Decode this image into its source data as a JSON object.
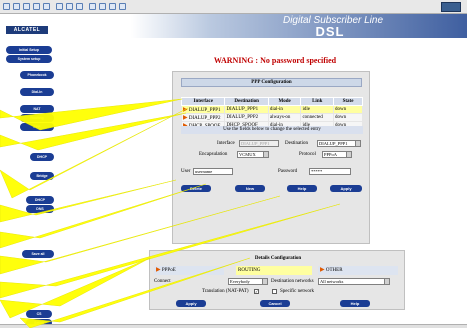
{
  "header": {
    "logo": "ALCATEL",
    "brand_line1": "Digital Subscriber Line",
    "brand_line2": "DSL"
  },
  "sidebar": {
    "items": [
      {
        "label": "Initial Setup"
      },
      {
        "label": "System setup"
      },
      {
        "label": "Phonebook"
      },
      {
        "label": "Dial-In"
      },
      {
        "label": "NAT"
      },
      {
        "label": "Routing"
      },
      {
        "label": "PPP"
      },
      {
        "label": "DHCP"
      },
      {
        "label": "Bridge"
      },
      {
        "label": "DHCP"
      },
      {
        "label": "DNS"
      },
      {
        "label": "Save all"
      },
      {
        "label": "CS"
      },
      {
        "label": "Setup"
      }
    ]
  },
  "warning": "WARNING : No password specified",
  "ppp_panel": {
    "title": "PPP Configuration",
    "columns": [
      "Interface",
      "Destination",
      "Mode",
      "Link",
      "State"
    ],
    "rows": [
      {
        "interface": "DIALUP_PPP1",
        "destination": "DIALUP_PPP1",
        "mode": "dial-in",
        "link": "idle",
        "state": "down"
      },
      {
        "interface": "DIALUP_PPP2",
        "destination": "DIALUP_PPP2",
        "mode": "always-on",
        "link": "connected",
        "state": "down"
      },
      {
        "interface": "DHCP_SPOOF",
        "destination": "DHCP_SPOOF",
        "mode": "dial-in",
        "link": "idle",
        "state": "down"
      }
    ],
    "hint": "Use the fields below to change the selected entry",
    "interface_label": "Interface",
    "interface_value": "DIALUP_PPP1",
    "destination_label": "Destination",
    "destination_value": "DIALUP_PPP1",
    "encapsulation_label": "Encapsulation",
    "encapsulation_value": "VCMUX",
    "protocol_label": "Protocol",
    "protocol_value": "PPPoA",
    "user_label": "User",
    "user_value": "username",
    "password_label": "Password",
    "password_value": "*****",
    "buttons": {
      "delete": "Delete",
      "new": "New",
      "help": "Help",
      "apply": "Apply"
    }
  },
  "details_panel": {
    "title": "Details Configuration",
    "tabs": {
      "pppoe": "PPPoE",
      "routing": "ROUTING",
      "other": "OTHER"
    },
    "connect_label": "Connect",
    "connect_value": "Everybody",
    "dest_networks_label": "Destination networks",
    "dest_networks_value": "All networks",
    "nat_label": "Translation (NAT-PAT)",
    "specific_label": "Specific network",
    "buttons": {
      "apply": "Apply",
      "cancel": "Cancel",
      "help": "Help"
    }
  },
  "colors": {
    "nav_blue": "#1b3d94",
    "warning_red": "#c00000",
    "selection_yellow": "#ffffa0",
    "beam_yellow": "#ffff00"
  }
}
